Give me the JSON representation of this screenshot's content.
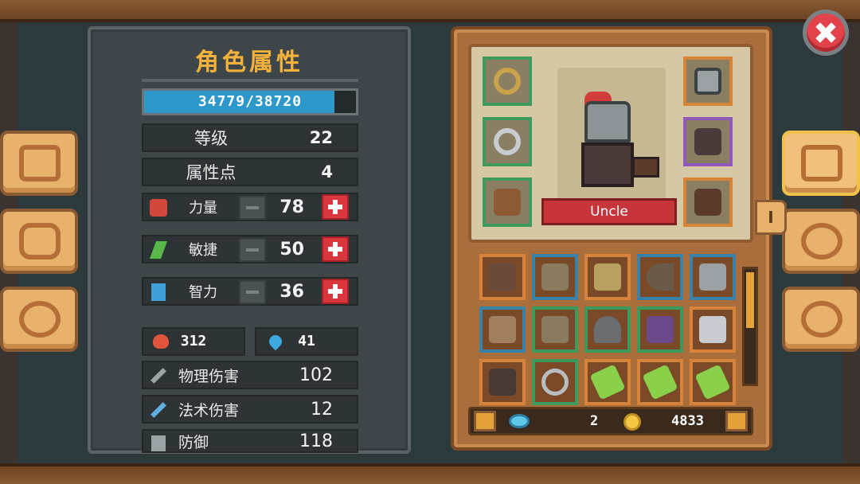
{
  "panel": {
    "title": "角色属性",
    "hp": {
      "text": "34779/38720",
      "fraction": 0.898
    }
  },
  "summary": [
    {
      "label": "等级",
      "value": "22"
    },
    {
      "label": "属性点",
      "value": "4"
    }
  ],
  "attributes": [
    {
      "label": "力量",
      "value": "78",
      "icon": "fist-icon",
      "color": "#d2483c"
    },
    {
      "label": "敏捷",
      "value": "50",
      "icon": "feather-icon",
      "color": "#58b84a"
    },
    {
      "label": "智力",
      "value": "36",
      "icon": "book-icon",
      "color": "#3ea0d8"
    }
  ],
  "vitals": {
    "health": {
      "value": "312",
      "icon": "heart-icon"
    },
    "mana": {
      "value": "41",
      "icon": "water-drop-icon"
    }
  },
  "derived": [
    {
      "label": "物理伤害",
      "value": "102",
      "icon": "sword-icon"
    },
    {
      "label": "法术伤害",
      "value": "12",
      "icon": "wand-icon"
    },
    {
      "label": "防御",
      "value": "118",
      "icon": "shield-icon"
    }
  ],
  "character": {
    "name": "Uncle"
  },
  "equipment_tab": "I",
  "currency": {
    "gems": "2",
    "gold": "4833"
  },
  "side_menu_left": [
    "journal-icon",
    "hexagon-skill-icon",
    "gear-target-icon"
  ],
  "side_menu_right": [
    "helmet-icon",
    "spiral-icon",
    "settings-gear-icon"
  ],
  "colors": {
    "accent": "#f2b23c",
    "hp_bar": "#2d98c9",
    "plus_button": "#d9363e",
    "banner": "#c7343a"
  }
}
